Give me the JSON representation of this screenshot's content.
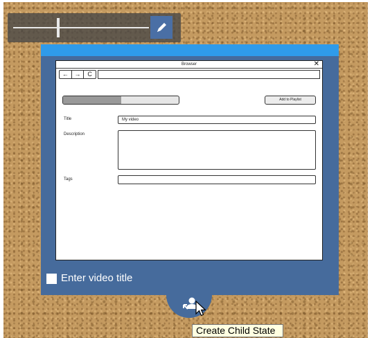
{
  "toolbar": {
    "zoom_level": 0.33,
    "edit_icon": "pencil-icon"
  },
  "mockup": {
    "window_title": "Browser",
    "close_glyph": "✕",
    "nav": {
      "back": "←",
      "forward": "→",
      "refresh": "C"
    },
    "url": "",
    "progress": 0.5,
    "add_button_label": "Add to Playlist",
    "title_label": "Title",
    "title_value": "My video",
    "description_label": "Description",
    "description_value": "",
    "tags_label": "Tags",
    "tags_value": ""
  },
  "panel": {
    "checkbox_label": "Enter video title",
    "checkbox_checked": false,
    "accent_color": "#2f9bea",
    "panel_color": "#466b9c",
    "tab_icon": "create-child-state-icon"
  },
  "tooltip": {
    "text": "Create Child State"
  }
}
